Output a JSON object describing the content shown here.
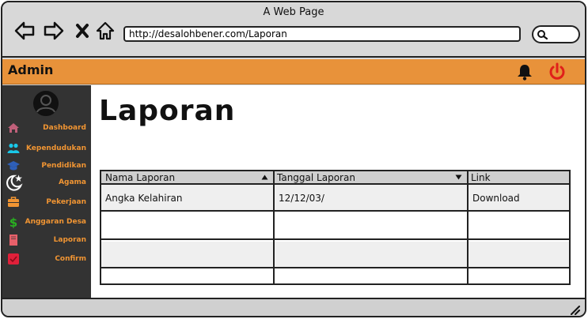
{
  "window": {
    "title": "A Web Page"
  },
  "address_bar": {
    "url": "http://desalohbener.com/Laporan"
  },
  "topbar": {
    "brand": "Admin"
  },
  "sidebar": {
    "items": [
      {
        "label": "Dashboard",
        "icon": "home-icon",
        "color": "#c0607a"
      },
      {
        "label": "Kependudukan",
        "icon": "users-icon",
        "color": "#19c8e8"
      },
      {
        "label": "Pendidikan",
        "icon": "graduation-cap-icon",
        "color": "#2e5fb8"
      },
      {
        "label": "Agama",
        "icon": "moon-star-icon",
        "color": "#ffffff"
      },
      {
        "label": "Pekerjaan",
        "icon": "briefcase-icon",
        "color": "#f19533"
      },
      {
        "label": "Anggaran Desa",
        "icon": "dollar-icon",
        "color": "#29b020"
      },
      {
        "label": "Laporan",
        "icon": "book-icon",
        "color": "#e8606a"
      },
      {
        "label": "Confirm",
        "icon": "check-square-icon",
        "color": "#e0203a"
      }
    ]
  },
  "main": {
    "title": "Laporan"
  },
  "table": {
    "columns": [
      "Nama Laporan",
      "Tanggal Laporan",
      "Link"
    ],
    "rows": [
      [
        "Angka Kelahiran",
        "12/12/03/",
        "Download"
      ],
      [
        "",
        "",
        ""
      ],
      [
        "",
        "",
        ""
      ],
      [
        "",
        "",
        ""
      ]
    ]
  },
  "colors": {
    "accent": "#e8923a",
    "sidebar_bg": "#333333",
    "sidebar_text": "#f19533",
    "power": "#e0201a"
  }
}
